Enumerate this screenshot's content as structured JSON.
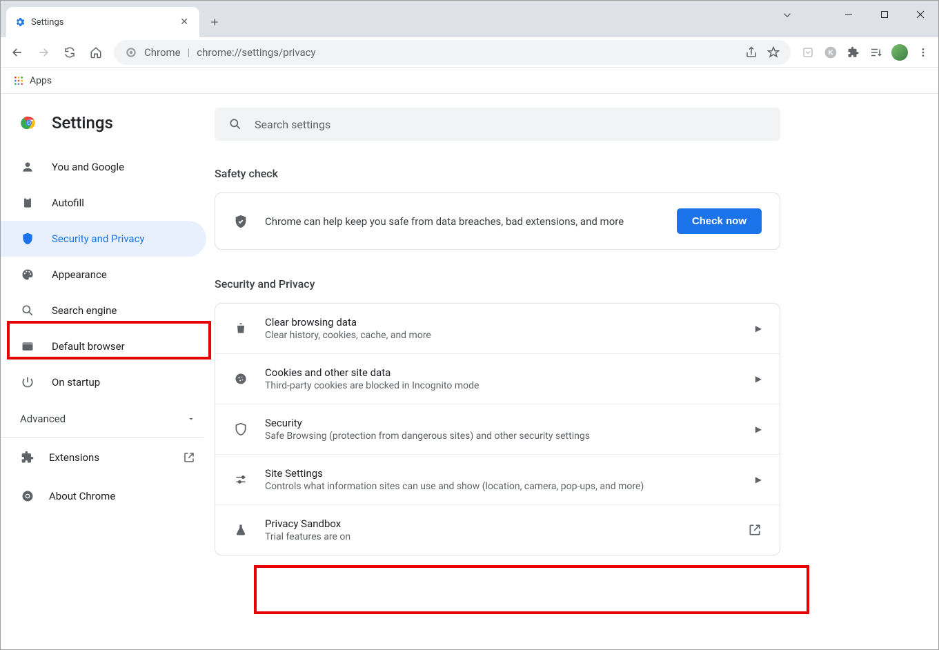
{
  "window": {
    "tab_title": "Settings",
    "url_scheme": "Chrome",
    "url_path": "chrome://settings/privacy"
  },
  "bookmarks": {
    "apps": "Apps"
  },
  "header": {
    "title": "Settings"
  },
  "search": {
    "placeholder": "Search settings"
  },
  "sidebar": {
    "items": [
      {
        "label": "You and Google"
      },
      {
        "label": "Autofill"
      },
      {
        "label": "Security and Privacy"
      },
      {
        "label": "Appearance"
      },
      {
        "label": "Search engine"
      },
      {
        "label": "Default browser"
      },
      {
        "label": "On startup"
      }
    ],
    "advanced": "Advanced",
    "extensions": "Extensions",
    "about": "About Chrome"
  },
  "safety": {
    "heading": "Safety check",
    "text": "Chrome can help keep you safe from data breaches, bad extensions, and more",
    "button": "Check now"
  },
  "privacy": {
    "heading": "Security and Privacy",
    "rows": [
      {
        "title": "Clear browsing data",
        "sub": "Clear history, cookies, cache, and more"
      },
      {
        "title": "Cookies and other site data",
        "sub": "Third-party cookies are blocked in Incognito mode"
      },
      {
        "title": "Security",
        "sub": "Safe Browsing (protection from dangerous sites) and other security settings"
      },
      {
        "title": "Site Settings",
        "sub": "Controls what information sites can use and show (location, camera, pop-ups, and more)"
      },
      {
        "title": "Privacy Sandbox",
        "sub": "Trial features are on"
      }
    ]
  }
}
